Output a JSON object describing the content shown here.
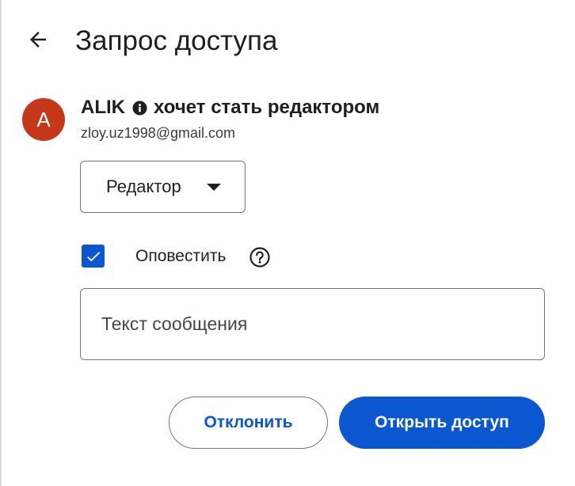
{
  "header": {
    "back_icon": "arrow-back-icon",
    "title": "Запрос доступа"
  },
  "requester": {
    "avatar_letter": "A",
    "avatar_color": "#c5391a",
    "name": "ALIK",
    "info_icon": "info-filled-icon",
    "request_text": "хочет стать редактором",
    "email": "zloy.uz1998@gmail.com"
  },
  "role_select": {
    "selected": "Редактор",
    "icon": "caret-down-icon"
  },
  "notify": {
    "checked": true,
    "label": "Оповестить",
    "help_icon": "help-circle-icon"
  },
  "message": {
    "placeholder": "Текст сообщения",
    "value": ""
  },
  "actions": {
    "decline_label": "Отклонить",
    "share_label": "Открыть доступ"
  },
  "colors": {
    "accent": "#0b57d0",
    "text": "#1f1f1f",
    "outline": "#747775"
  }
}
